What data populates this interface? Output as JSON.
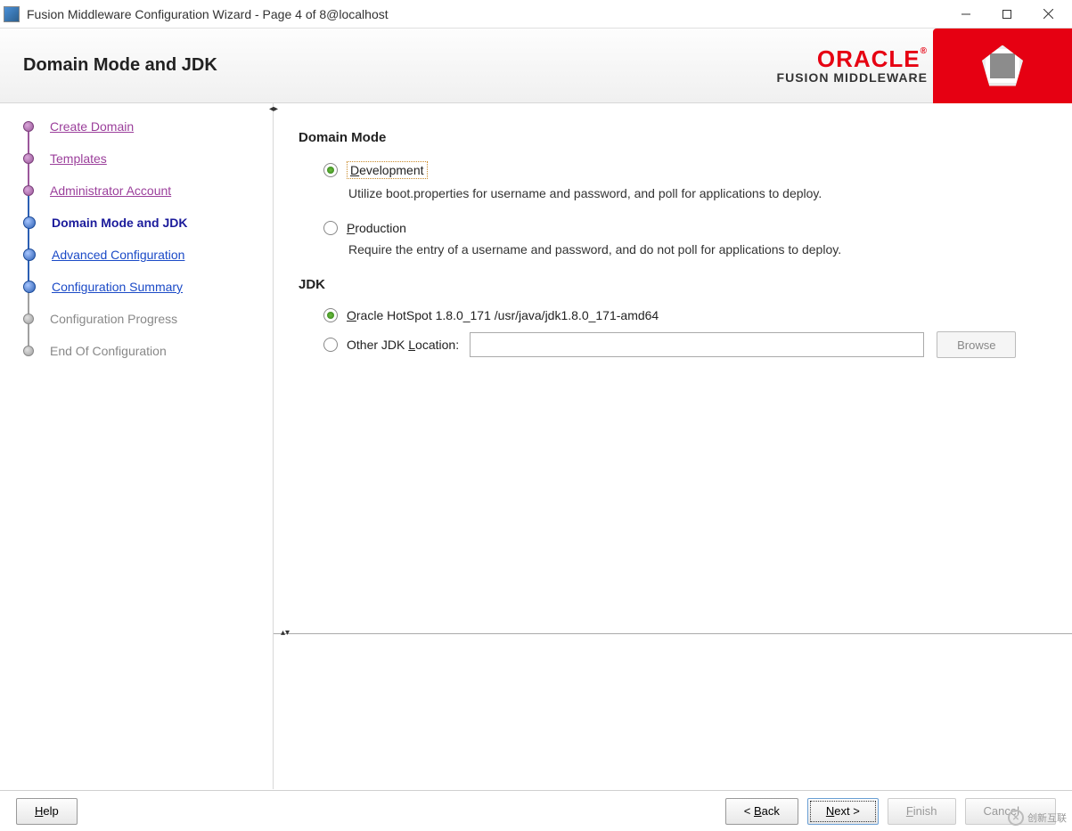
{
  "window": {
    "title": "Fusion Middleware Configuration Wizard - Page 4 of 8@localhost"
  },
  "header": {
    "title": "Domain Mode and JDK",
    "brand_main": "ORACLE",
    "brand_sub": "FUSION MIDDLEWARE"
  },
  "sidebar": {
    "steps": [
      {
        "label": "Create Domain",
        "state": "past"
      },
      {
        "label": "Templates",
        "state": "past"
      },
      {
        "label": "Administrator Account",
        "state": "past"
      },
      {
        "label": "Domain Mode and JDK",
        "state": "current"
      },
      {
        "label": "Advanced Configuration",
        "state": "future_link"
      },
      {
        "label": "Configuration Summary",
        "state": "future_link"
      },
      {
        "label": "Configuration Progress",
        "state": "disabled"
      },
      {
        "label": "End Of Configuration",
        "state": "disabled"
      }
    ]
  },
  "main": {
    "domain_mode": {
      "title": "Domain Mode",
      "options": [
        {
          "label": "Development",
          "selected": true,
          "desc": "Utilize boot.properties for username and password, and poll for applications to deploy."
        },
        {
          "label": "Production",
          "selected": false,
          "desc": "Require the entry of a username and password, and do not poll for applications to deploy."
        }
      ]
    },
    "jdk": {
      "title": "JDK",
      "oracle_label": "Oracle HotSpot 1.8.0_171 /usr/java/jdk1.8.0_171-amd64",
      "other_label": "Other JDK Location:",
      "other_value": "",
      "browse_label": "Browse"
    }
  },
  "footer": {
    "help": "Help",
    "back": "< Back",
    "next": "Next >",
    "finish": "Finish",
    "cancel": "Cancel"
  },
  "watermark": "创新互联"
}
